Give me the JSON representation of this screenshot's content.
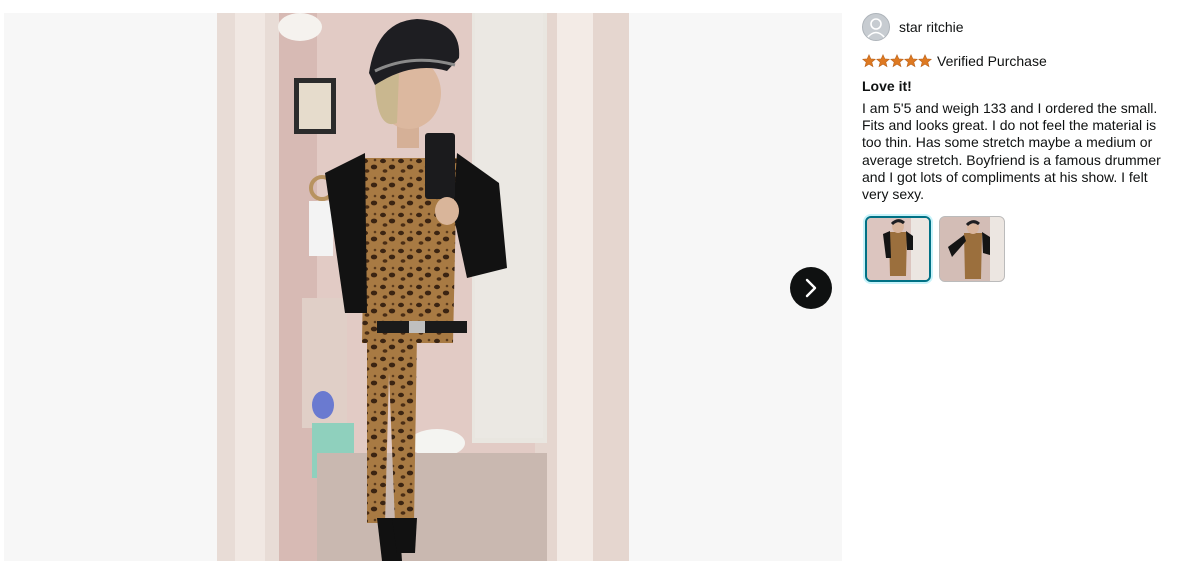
{
  "reviewer": {
    "name": "star ritchie",
    "avatar_icon": "person-avatar-icon"
  },
  "rating": {
    "stars": 5,
    "max": 5,
    "star_color": "#de7921",
    "verified_label": "Verified Purchase"
  },
  "review": {
    "title": "Love it!",
    "body": "I am 5'5 and weigh 133 and I ordered the small. Fits and looks great. I do not feel the material is too thin. Has some stretch maybe a medium or average stretch. Boyfriend is a famous drummer and I got lots of compliments at his show. I felt very sexy."
  },
  "gallery": {
    "next_icon": "chevron-right-icon",
    "thumbnail_count": 2,
    "selected_index": 0
  },
  "colors": {
    "accent": "#007185",
    "next_button": "#0f1111"
  }
}
